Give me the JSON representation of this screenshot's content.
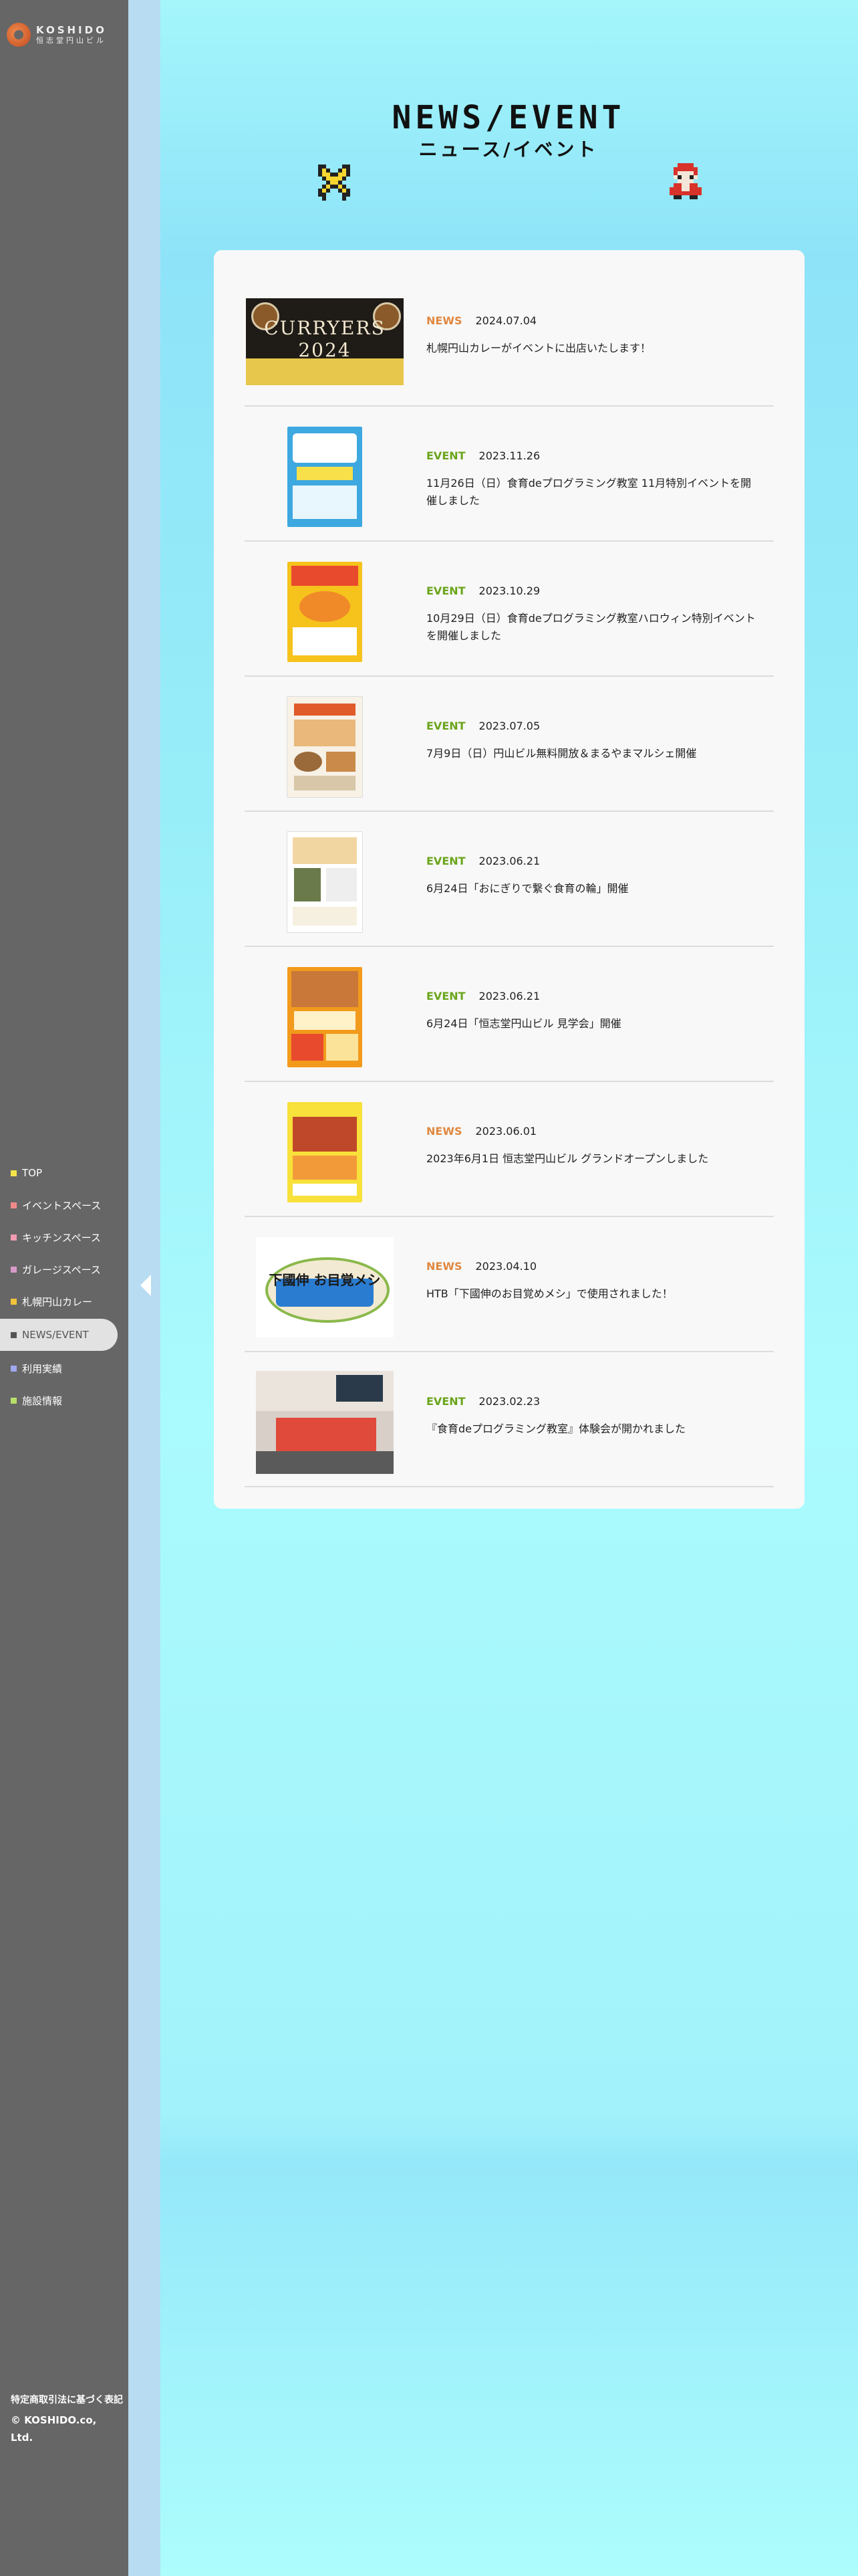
{
  "brand": {
    "name_en": "KOSHIDO",
    "name_jp": "恒志堂円山ビル",
    "accent": "#c04a20"
  },
  "nav": {
    "items": [
      {
        "label": "TOP",
        "color": "#f6e34a",
        "active": false
      },
      {
        "label": "イベントスペース",
        "color": "#f08a8a",
        "active": false
      },
      {
        "label": "キッチンスペース",
        "color": "#f29ab0",
        "active": false
      },
      {
        "label": "ガレージスペース",
        "color": "#d89ac8",
        "active": false
      },
      {
        "label": "札幌円山カレー",
        "color": "#f2c23a",
        "active": false
      },
      {
        "label": "NEWS/EVENT",
        "color": "#555555",
        "active": true
      },
      {
        "label": "利用実績",
        "color": "#9fa8f0",
        "active": false
      },
      {
        "label": "施設情報",
        "color": "#b7e06a",
        "active": false
      }
    ]
  },
  "footer": {
    "legal_link": "特定商取引法に基づく表記",
    "copyright": "© KOSHIDO.co, Ltd."
  },
  "page": {
    "title": "NEWS/EVENT",
    "subtitle": "ニュース/イベント"
  },
  "colors": {
    "news": "#e08840",
    "event": "#6aa51a",
    "sidebar": "#666666"
  },
  "entries": [
    {
      "category": "NEWS",
      "date": "2024.07.04",
      "title": "札幌円山カレーがイベントに出店いたします！",
      "thumb": "CURRYERS 2024"
    },
    {
      "category": "EVENT",
      "date": "2023.11.26",
      "title": "11月26日（日）食育deプログラミング教室 11月特別イベントを開催しました",
      "thumb": "programming-poster"
    },
    {
      "category": "EVENT",
      "date": "2023.10.29",
      "title": "10月29日（日）食育deプログラミング教室ハロウィン特別イベントを開催しました",
      "thumb": "halloween-poster"
    },
    {
      "category": "EVENT",
      "date": "2023.07.05",
      "title": "7月9日（日）円山ビル無料開放＆まるやまマルシェ開催",
      "thumb": "marche-poster"
    },
    {
      "category": "EVENT",
      "date": "2023.06.21",
      "title": "6月24日「おにぎりで繋ぐ食育の輪」開催",
      "thumb": "onigiri-poster"
    },
    {
      "category": "EVENT",
      "date": "2023.06.21",
      "title": "6月24日「恒志堂円山ビル 見学会」開催",
      "thumb": "tour-poster"
    },
    {
      "category": "NEWS",
      "date": "2023.06.01",
      "title": "2023年6月1日 恒志堂円山ビル グランドオープンしました",
      "thumb": "grand-open-poster"
    },
    {
      "category": "NEWS",
      "date": "2023.04.10",
      "title": "HTB「下國伸のお目覚めメシ」で使用されました！",
      "thumb": "下國伸 お目覚メシ"
    },
    {
      "category": "EVENT",
      "date": "2023.02.23",
      "title": "『食育deプログラミング教室』体験会が開かれました",
      "thumb": "class-photo"
    }
  ]
}
